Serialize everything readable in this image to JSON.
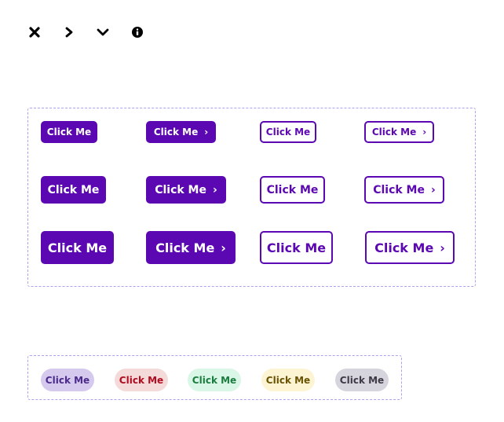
{
  "icons": [
    {
      "name": "close-icon"
    },
    {
      "name": "chevron-right-icon"
    },
    {
      "name": "chevron-down-icon"
    },
    {
      "name": "info-icon"
    }
  ],
  "colors": {
    "primary": "#5c08b2",
    "frame_border": "#a9a3f0"
  },
  "buttons": {
    "label": "Click Me",
    "rows": [
      {
        "size": "small",
        "items": [
          "Click Me",
          "Click Me",
          "Click Me",
          "Click Me"
        ]
      },
      {
        "size": "medium",
        "items": [
          "Click Me",
          "Click Me",
          "Click Me",
          "Click Me"
        ]
      },
      {
        "size": "large",
        "items": [
          "Click Me",
          "Click Me",
          "Click Me",
          "Click Me"
        ]
      }
    ],
    "chevron_glyph": "›"
  },
  "pills": [
    {
      "label": "Click Me",
      "variant": "purple",
      "bg": "#d5c9ee",
      "fg": "#4b2a8c"
    },
    {
      "label": "Click Me",
      "variant": "red",
      "bg": "#f5dada",
      "fg": "#b00b1e"
    },
    {
      "label": "Click Me",
      "variant": "green",
      "bg": "#d9f6e6",
      "fg": "#1a7d3f"
    },
    {
      "label": "Click Me",
      "variant": "yellow",
      "bg": "#fcf4d2",
      "fg": "#6b5304"
    },
    {
      "label": "Click Me",
      "variant": "gray",
      "bg": "#d6d4dd",
      "fg": "#3d3a46"
    }
  ]
}
